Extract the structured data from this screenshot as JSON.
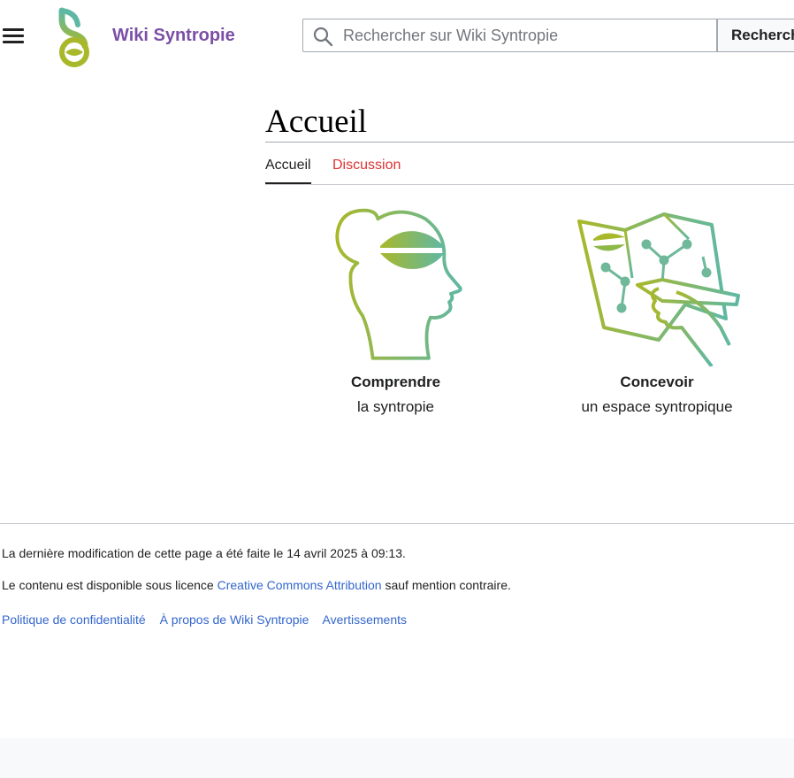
{
  "header": {
    "site_title": "Wiki Syntropie",
    "search": {
      "placeholder": "Rechercher sur Wiki Syntropie",
      "value": "",
      "button_label": "Rechercher"
    }
  },
  "page": {
    "title": "Accueil",
    "tabs": [
      {
        "label": "Accueil",
        "selected": true
      },
      {
        "label": "Discussion",
        "selected": false
      }
    ]
  },
  "cards": [
    {
      "title": "Comprendre",
      "subtitle": "la syntropie",
      "icon": "head-with-seed-icon"
    },
    {
      "title": "Concevoir",
      "subtitle": "un espace syntropique",
      "icon": "hand-drawing-map-icon"
    }
  ],
  "footer": {
    "last_modified": "La dernière modification de cette page a été faite le 14 avril 2025 à 09:13.",
    "license_prefix": "Le contenu est disponible sous licence ",
    "license_link": "Creative Commons Attribution",
    "license_suffix": " sauf mention contraire.",
    "links": [
      "Politique de confidentialité",
      "À propos de Wiki Syntropie",
      "Avertissements"
    ]
  },
  "colors": {
    "brand_purple": "#7b4fa6",
    "link_blue": "#3366cc",
    "redlink": "#dd3333",
    "gradient_start": "#a8b82a",
    "gradient_end": "#5fb8a4"
  }
}
